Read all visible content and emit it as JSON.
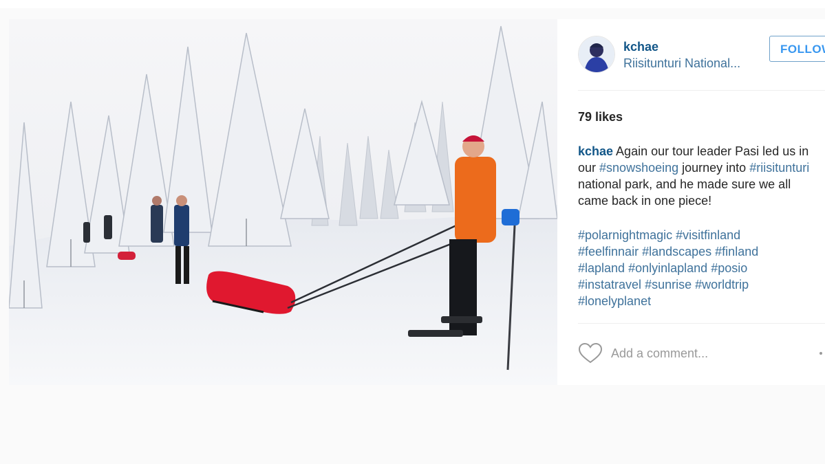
{
  "post": {
    "username": "kchae",
    "location": "Riisitunturi National...",
    "follow_label": "FOLLOW",
    "likes": "79 likes",
    "caption": {
      "author": "kchae",
      "text_before": " Again our tour leader Pasi led us in our ",
      "tag": "#snowshoeing",
      "text_middle": " journey into ",
      "tag2": "#riisitunturi",
      "text_after": " national park, and he made sure we all came back in one piece!"
    },
    "hashtags": [
      "#polarnightmagic",
      "#visitfinland",
      "#feelfinnair",
      "#landscapes",
      "#finland",
      "#lapland",
      "#onlyinlapland",
      "#posio",
      "#instatravel",
      "#sunrise",
      "#worldtrip",
      "#lonelyplanet"
    ],
    "comment_placeholder": "Add a comment..."
  },
  "icons": {
    "like": "heart-outline-icon",
    "more": "more-options-icon"
  },
  "colors": {
    "username": "#125688",
    "link": "#3f729b",
    "follow": "#3897f0",
    "text": "#262626",
    "background": "#fafafa"
  }
}
